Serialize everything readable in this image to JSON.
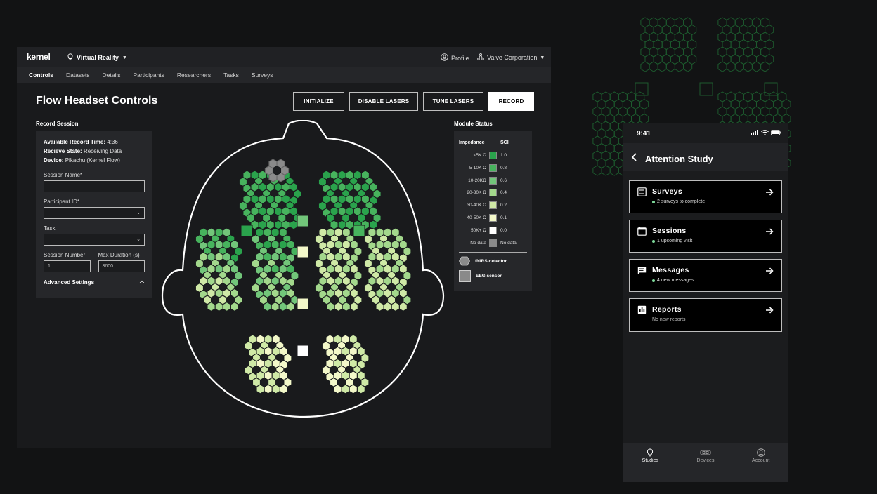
{
  "app": {
    "logo": "kernel",
    "project": "Virtual Reality",
    "profile_label": "Profile",
    "org_label": "Valve Corporation",
    "nav": [
      "Controls",
      "Datasets",
      "Details",
      "Participants",
      "Researchers",
      "Tasks",
      "Surveys"
    ],
    "active_nav": "Controls",
    "page_title": "Flow Headset Controls",
    "buttons": {
      "initialize": "INITIALIZE",
      "disable_lasers": "DISABLE LASERS",
      "tune_lasers": "TUNE LASERS",
      "record": "RECORD"
    }
  },
  "record_session": {
    "heading": "Record Session",
    "available_label": "Available Record Time:",
    "available_value": "4:36",
    "receive_label": "Recieve State:",
    "receive_value": "Receiving Data",
    "device_label": "Device:",
    "device_value": "Pikachu (Kernel Flow)",
    "session_name_label": "Session Name*",
    "session_name_value": "",
    "participant_label": "Participant ID*",
    "participant_value": "",
    "task_label": "Task",
    "task_value": "",
    "session_number_label": "Session Number",
    "session_number_value": "1",
    "max_duration_label": "Max Duration (s)",
    "max_duration_value": "3600",
    "advanced_label": "Advanced Settings"
  },
  "module_status": {
    "heading": "Module Status",
    "impedance_header": "Impedance",
    "sci_header": "SCI",
    "legend": [
      {
        "impedance": "<5K Ω",
        "sci": "1.0",
        "color": "#2aa34c"
      },
      {
        "impedance": "5-10K Ω",
        "sci": "0.8",
        "color": "#47b35d"
      },
      {
        "impedance": "10-20KΩ",
        "sci": "0.6",
        "color": "#72c67a"
      },
      {
        "impedance": "20-30K Ω",
        "sci": "0.4",
        "color": "#a3d88c"
      },
      {
        "impedance": "30-40K Ω",
        "sci": "0.2",
        "color": "#cfe9a6"
      },
      {
        "impedance": "40-50K Ω",
        "sci": "0.1",
        "color": "#f3f8c9"
      },
      {
        "impedance": "50K+ Ω",
        "sci": "0.0",
        "color": "#ffffff"
      },
      {
        "impedance": "No data",
        "sci": "No data",
        "color": "#8a8a8a"
      }
    ],
    "fnirs_label": "fNIRS detector",
    "eeg_label": "EEG sensor"
  },
  "mobile": {
    "time": "9:41",
    "title": "Attention Study",
    "cards": [
      {
        "title": "Surveys",
        "subtitle": "2 surveys to complete",
        "dot": true,
        "icon": "list-icon"
      },
      {
        "title": "Sessions",
        "subtitle": "1 upcoming visit",
        "dot": true,
        "icon": "calendar-icon"
      },
      {
        "title": "Messages",
        "subtitle": "4 new messages",
        "dot": true,
        "icon": "message-icon"
      },
      {
        "title": "Reports",
        "subtitle": "No new reports",
        "dot": false,
        "icon": "bar-chart-icon"
      }
    ],
    "tabs": [
      "Studies",
      "Devices",
      "Account"
    ],
    "active_tab": "Studies"
  }
}
